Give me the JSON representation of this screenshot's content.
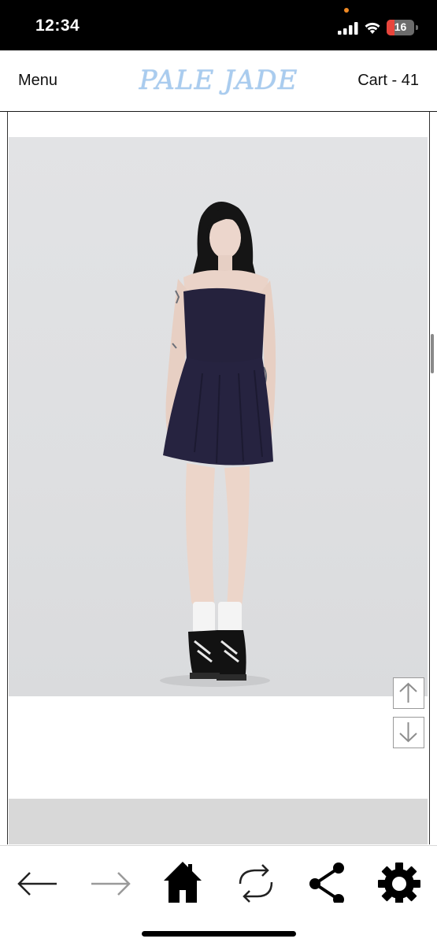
{
  "status_bar": {
    "time": "12:34",
    "battery_level": "16",
    "icons": [
      "cellular-signal-icon",
      "wifi-icon",
      "battery-icon"
    ]
  },
  "header": {
    "menu_label": "Menu",
    "logo_text": "PALE JADE",
    "cart_label": "Cart - 41"
  },
  "content": {
    "product_image": "model-wearing-navy-strapless-mini-dress-photo",
    "scroll_up_icon": "arrow-up-icon",
    "scroll_down_icon": "arrow-down-icon"
  },
  "toolbar": {
    "icons": [
      "back-arrow-icon",
      "forward-arrow-icon",
      "home-icon",
      "refresh-icon",
      "share-icon",
      "settings-gear-icon"
    ]
  },
  "colors": {
    "logo": "#a9ccef",
    "status_bar_bg": "#000000",
    "battery_low": "#e8453c",
    "photo_bg": "#dedfe1",
    "dress": "#24223d"
  }
}
